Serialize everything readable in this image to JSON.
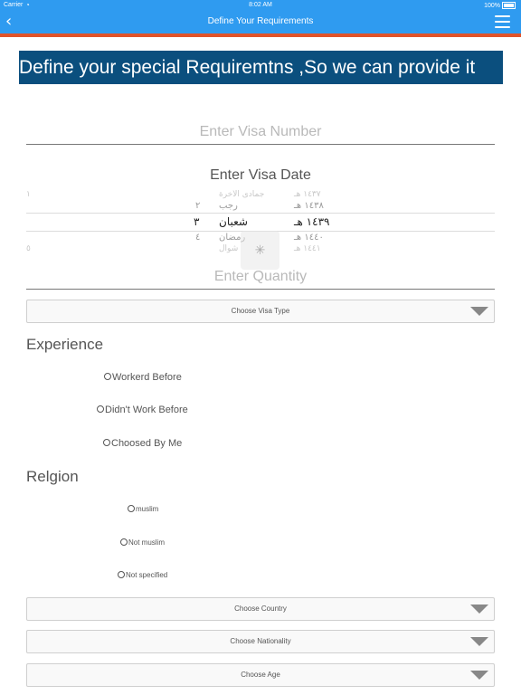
{
  "status_bar": {
    "carrier": "Carrier",
    "time": "8:02 AM",
    "battery": "100%"
  },
  "nav": {
    "title": "Define Your Requirements",
    "back_icon": "chevron-left-icon",
    "menu_icon": "hamburger-menu-icon"
  },
  "colors": {
    "nav_blue": "#2f9bf0",
    "accent_orange": "#e0532a",
    "banner_navy": "#0b4f7e"
  },
  "banner": {
    "text": "Define your special Requiremtns ,So we can provide it"
  },
  "visa_number": {
    "placeholder": "Enter Visa Number"
  },
  "visa_date": {
    "label": "Enter Visa Date",
    "picker": {
      "rows": [
        {
          "year": "١٤٣٧ هـ",
          "month": "جمادى الآخرة",
          "day": "١"
        },
        {
          "year": "١٤٣٨ هـ",
          "month": "رجب",
          "day": "٢"
        },
        {
          "year": "١٤٣٩ هـ",
          "month": "شعبان",
          "day": "٣"
        },
        {
          "year": "١٤٤٠ هـ",
          "month": "رمضان",
          "day": "٤"
        },
        {
          "year": "١٤٤١ هـ",
          "month": "شوال",
          "day": "٥"
        }
      ]
    }
  },
  "quantity": {
    "placeholder": "Enter Quantity"
  },
  "visa_type": {
    "label": "Choose Visa Type"
  },
  "experience": {
    "heading": "Experience",
    "options": [
      "Workerd Before",
      "Didn't Work Before",
      "Choosed By Me"
    ]
  },
  "religion": {
    "heading": "Relgion",
    "options": [
      "muslim",
      "Not muslim",
      "Not specified"
    ]
  },
  "dropdowns": {
    "country": "Choose Country",
    "nationality": "Choose Nationality",
    "age": "Choose Age"
  }
}
